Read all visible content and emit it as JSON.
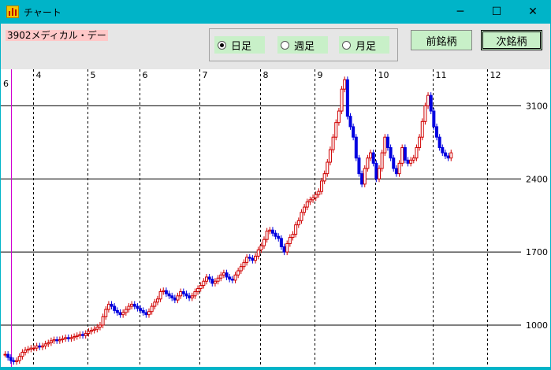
{
  "window": {
    "title": "チャート",
    "minimize": "─",
    "maximize": "☐",
    "close": "✕"
  },
  "toolbar": {
    "stock": "3902メディカル・デー",
    "radios": [
      {
        "label": "日足",
        "checked": true
      },
      {
        "label": "週足",
        "checked": false
      },
      {
        "label": "月足",
        "checked": false
      }
    ],
    "prev_label": "前銘柄",
    "next_label": "次銘柄"
  },
  "chart_data": {
    "type": "candlestick",
    "x_labels": [
      "6",
      "4",
      "5",
      "6",
      "7",
      "8",
      "9",
      "10",
      "11",
      "12"
    ],
    "y_ticks": [
      3100,
      2400,
      1700,
      1000
    ],
    "ylim": [
      600,
      3450
    ],
    "up_color": "#d00000",
    "down_color": "#0000e0",
    "closes": [
      720,
      690,
      660,
      650,
      660,
      700,
      740,
      760,
      770,
      780,
      780,
      800,
      790,
      800,
      820,
      830,
      850,
      860,
      850,
      860,
      870,
      880,
      870,
      880,
      890,
      900,
      910,
      900,
      920,
      940,
      950,
      960,
      980,
      1000,
      1080,
      1150,
      1200,
      1180,
      1140,
      1120,
      1100,
      1120,
      1150,
      1180,
      1200,
      1180,
      1160,
      1140,
      1120,
      1100,
      1130,
      1180,
      1220,
      1250,
      1320,
      1330,
      1300,
      1280,
      1260,
      1240,
      1280,
      1320,
      1300,
      1280,
      1260,
      1280,
      1320,
      1350,
      1380,
      1420,
      1460,
      1440,
      1400,
      1420,
      1450,
      1480,
      1500,
      1460,
      1440,
      1430,
      1480,
      1520,
      1560,
      1600,
      1650,
      1640,
      1620,
      1660,
      1720,
      1760,
      1820,
      1900,
      1910,
      1880,
      1850,
      1830,
      1750,
      1700,
      1780,
      1840,
      1870,
      1960,
      2000,
      2080,
      2130,
      2180,
      2200,
      2220,
      2250,
      2280,
      2380,
      2450,
      2560,
      2680,
      2800,
      2940,
      3050,
      3260,
      3350,
      3000,
      2900,
      2800,
      2600,
      2450,
      2350,
      2500,
      2600,
      2650,
      2550,
      2400,
      2500,
      2650,
      2800,
      2700,
      2600,
      2500,
      2450,
      2550,
      2700,
      2580,
      2550,
      2580,
      2600,
      2700,
      2800,
      2950,
      3100,
      3200,
      3050,
      2900,
      2800,
      2700,
      2650,
      2620,
      2600,
      2650
    ],
    "month_labels": [
      {
        "label": "4",
        "index": 10
      },
      {
        "label": "5",
        "index": 29
      },
      {
        "label": "6",
        "index": 47
      },
      {
        "label": "7",
        "index": 68
      },
      {
        "label": "8",
        "index": 89
      },
      {
        "label": "9",
        "index": 108
      },
      {
        "label": "10",
        "index": 129
      },
      {
        "label": "11",
        "index": 149
      },
      {
        "label": "12",
        "index": 168
      }
    ]
  }
}
